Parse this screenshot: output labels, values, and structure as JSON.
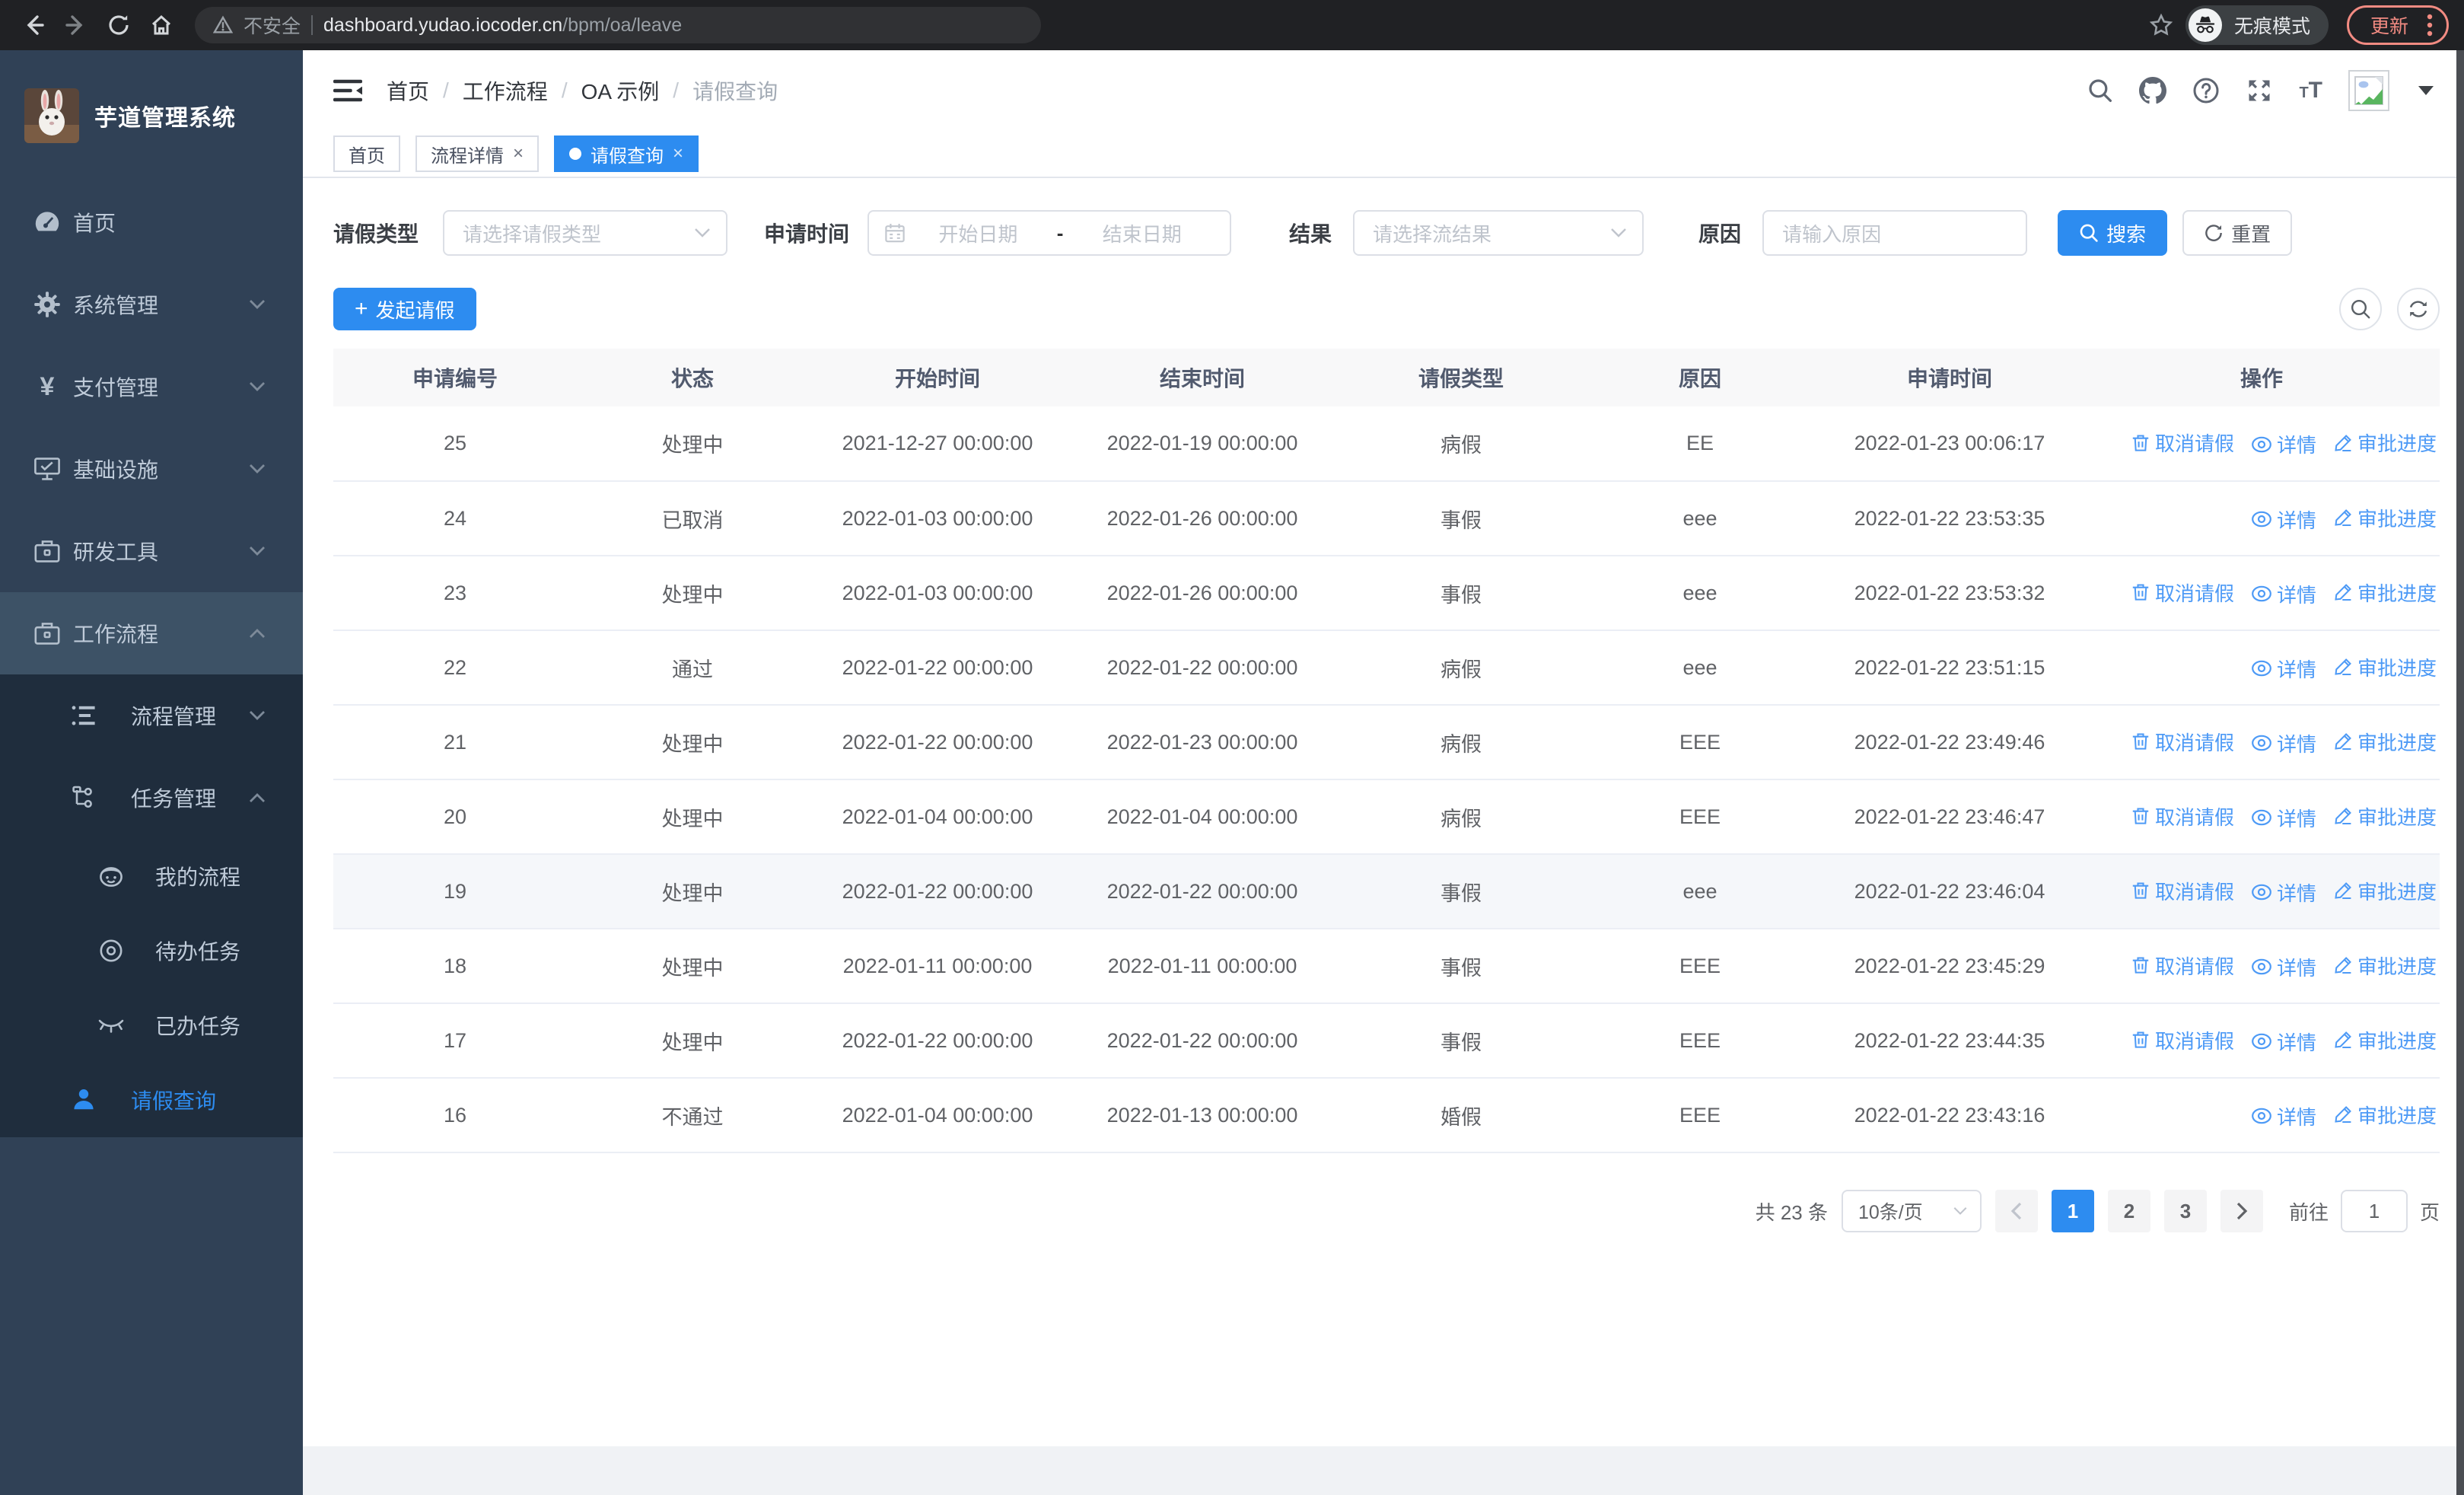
{
  "browser": {
    "security_label": "不安全",
    "url_host": "dashboard.yudao.iocoder.cn",
    "url_path": "/bpm/oa/leave",
    "incognito_label": "无痕模式",
    "update_label": "更新"
  },
  "app": {
    "title": "芋道管理系统",
    "accent": "#2d8cf0",
    "sidebar_bg": "#304156",
    "sidebar_sub_bg": "#1f2d3d"
  },
  "sidebar": {
    "items": [
      {
        "key": "home",
        "label": "首页",
        "icon": "dashboard-icon",
        "level": 1,
        "section": "root"
      },
      {
        "key": "system",
        "label": "系统管理",
        "icon": "gear-icon",
        "level": 1,
        "chevron": "down",
        "section": "root"
      },
      {
        "key": "payment",
        "label": "支付管理",
        "icon": "yen-icon",
        "level": 1,
        "chevron": "down",
        "section": "root"
      },
      {
        "key": "infra",
        "label": "基础设施",
        "icon": "monitor-icon",
        "level": 1,
        "chevron": "down",
        "section": "root"
      },
      {
        "key": "devtools",
        "label": "研发工具",
        "icon": "toolbox-icon",
        "level": 1,
        "chevron": "down",
        "section": "root"
      },
      {
        "key": "workflow",
        "label": "工作流程",
        "icon": "briefcase-icon",
        "level": 1,
        "chevron": "up",
        "open": true,
        "section": "root"
      },
      {
        "key": "process-mgmt",
        "label": "流程管理",
        "icon": "list-icon",
        "level": 2,
        "chevron": "down",
        "section": "sub"
      },
      {
        "key": "task-mgmt",
        "label": "任务管理",
        "icon": "flow-icon",
        "level": 2,
        "chevron": "up",
        "section": "sub"
      },
      {
        "key": "my-process",
        "label": "我的流程",
        "icon": "face-icon",
        "level": 3,
        "compact": true,
        "section": "sub"
      },
      {
        "key": "todo-tasks",
        "label": "待办任务",
        "icon": "eye-open-icon",
        "level": 3,
        "compact": true,
        "section": "sub"
      },
      {
        "key": "done-tasks",
        "label": "已办任务",
        "icon": "eye-closed-icon",
        "level": 3,
        "compact": true,
        "section": "sub"
      },
      {
        "key": "leave-query",
        "label": "请假查询",
        "icon": "user-icon",
        "level": 2,
        "compact": true,
        "active": true,
        "section": "sub"
      }
    ]
  },
  "header": {
    "breadcrumb": [
      "首页",
      "工作流程",
      "OA 示例",
      "请假查询"
    ]
  },
  "tabs": [
    {
      "key": "home",
      "label": "首页",
      "closable": false,
      "active": false
    },
    {
      "key": "process-detail",
      "label": "流程详情",
      "closable": true,
      "active": false
    },
    {
      "key": "leave-query",
      "label": "请假查询",
      "closable": true,
      "active": true
    }
  ],
  "filters": {
    "type_label": "请假类型",
    "type_placeholder": "请选择请假类型",
    "time_label": "申请时间",
    "time_start_placeholder": "开始日期",
    "time_separator": "-",
    "time_end_placeholder": "结束日期",
    "result_label": "结果",
    "result_placeholder": "请选择流结果",
    "reason_label": "原因",
    "reason_placeholder": "请输入原因",
    "search_label": "搜索",
    "reset_label": "重置"
  },
  "toolbar": {
    "create_label": "发起请假"
  },
  "table": {
    "columns": [
      "申请编号",
      "状态",
      "开始时间",
      "结束时间",
      "请假类型",
      "原因",
      "申请时间",
      "操作"
    ],
    "action_labels": {
      "cancel": "取消请假",
      "detail": "详情",
      "progress": "审批进度"
    },
    "rows": [
      {
        "id": "25",
        "status": "处理中",
        "start": "2021-12-27 00:00:00",
        "end": "2022-01-19 00:00:00",
        "type": "病假",
        "reason": "EE",
        "applied": "2022-01-23 00:06:17",
        "actions": [
          "cancel",
          "detail",
          "progress"
        ],
        "highlight": false
      },
      {
        "id": "24",
        "status": "已取消",
        "start": "2022-01-03 00:00:00",
        "end": "2022-01-26 00:00:00",
        "type": "事假",
        "reason": "eee",
        "applied": "2022-01-22 23:53:35",
        "actions": [
          "detail",
          "progress"
        ],
        "highlight": false
      },
      {
        "id": "23",
        "status": "处理中",
        "start": "2022-01-03 00:00:00",
        "end": "2022-01-26 00:00:00",
        "type": "事假",
        "reason": "eee",
        "applied": "2022-01-22 23:53:32",
        "actions": [
          "cancel",
          "detail",
          "progress"
        ],
        "highlight": false
      },
      {
        "id": "22",
        "status": "通过",
        "start": "2022-01-22 00:00:00",
        "end": "2022-01-22 00:00:00",
        "type": "病假",
        "reason": "eee",
        "applied": "2022-01-22 23:51:15",
        "actions": [
          "detail",
          "progress"
        ],
        "highlight": false
      },
      {
        "id": "21",
        "status": "处理中",
        "start": "2022-01-22 00:00:00",
        "end": "2022-01-23 00:00:00",
        "type": "病假",
        "reason": "EEE",
        "applied": "2022-01-22 23:49:46",
        "actions": [
          "cancel",
          "detail",
          "progress"
        ],
        "highlight": false
      },
      {
        "id": "20",
        "status": "处理中",
        "start": "2022-01-04 00:00:00",
        "end": "2022-01-04 00:00:00",
        "type": "病假",
        "reason": "EEE",
        "applied": "2022-01-22 23:46:47",
        "actions": [
          "cancel",
          "detail",
          "progress"
        ],
        "highlight": false
      },
      {
        "id": "19",
        "status": "处理中",
        "start": "2022-01-22 00:00:00",
        "end": "2022-01-22 00:00:00",
        "type": "事假",
        "reason": "eee",
        "applied": "2022-01-22 23:46:04",
        "actions": [
          "cancel",
          "detail",
          "progress"
        ],
        "highlight": true
      },
      {
        "id": "18",
        "status": "处理中",
        "start": "2022-01-11 00:00:00",
        "end": "2022-01-11 00:00:00",
        "type": "事假",
        "reason": "EEE",
        "applied": "2022-01-22 23:45:29",
        "actions": [
          "cancel",
          "detail",
          "progress"
        ],
        "highlight": false
      },
      {
        "id": "17",
        "status": "处理中",
        "start": "2022-01-22 00:00:00",
        "end": "2022-01-22 00:00:00",
        "type": "事假",
        "reason": "EEE",
        "applied": "2022-01-22 23:44:35",
        "actions": [
          "cancel",
          "detail",
          "progress"
        ],
        "highlight": false
      },
      {
        "id": "16",
        "status": "不通过",
        "start": "2022-01-04 00:00:00",
        "end": "2022-01-13 00:00:00",
        "type": "婚假",
        "reason": "EEE",
        "applied": "2022-01-22 23:43:16",
        "actions": [
          "detail",
          "progress"
        ],
        "highlight": false
      }
    ]
  },
  "pagination": {
    "total_label": "共 23 条",
    "page_size_label": "10条/页",
    "pages": [
      "1",
      "2",
      "3"
    ],
    "active_page": "1",
    "goto_label": "前往",
    "goto_value": "1",
    "goto_suffix": "页"
  }
}
